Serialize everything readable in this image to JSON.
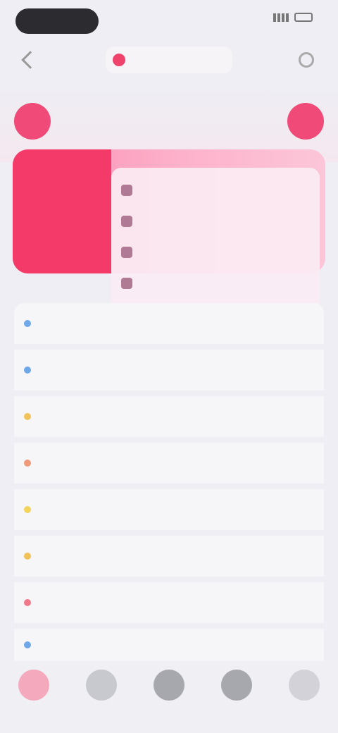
{
  "status_bar": {
    "time": "",
    "carrier": ""
  },
  "nav": {
    "title": ""
  },
  "hero": {
    "left_button": "",
    "right_button": "",
    "caption": ""
  },
  "feature": {
    "left_items": [
      "",
      ""
    ]
  },
  "menu": {
    "items": [
      {
        "label": "",
        "icon": "menu-icon"
      },
      {
        "label": "",
        "icon": "menu-icon"
      },
      {
        "label": "",
        "icon": "menu-icon"
      },
      {
        "label": "",
        "icon": "menu-icon"
      },
      {
        "label": "",
        "icon": "menu-icon"
      }
    ]
  },
  "list": {
    "rows": [
      {
        "label": "",
        "value": "",
        "color": "#6fa8e8"
      },
      {
        "label": "",
        "value": "",
        "color": "#6fa8e8"
      },
      {
        "label": "",
        "value": "",
        "color": "#f2c25a"
      },
      {
        "label": "",
        "value": "",
        "color": "#f09a7a"
      },
      {
        "label": "",
        "value": "",
        "color": "#f2d45a"
      },
      {
        "label": "",
        "value": "",
        "color": "#f2c25a"
      },
      {
        "label": "",
        "value": "",
        "color": "#f07a8a"
      },
      {
        "label": "",
        "value": "",
        "color": "#6fa8e8"
      }
    ]
  },
  "tabs": {
    "items": [
      {
        "label": "",
        "color": "#f4a9bd"
      },
      {
        "label": "",
        "color": "#c8c8cf"
      },
      {
        "label": "",
        "color": "#a7a7ae"
      },
      {
        "label": "",
        "color": "#a7a7ae"
      },
      {
        "label": "",
        "color": "#d2d2d8"
      }
    ]
  },
  "colors": {
    "accent": "#f43a68",
    "background": "#eeeef4"
  }
}
